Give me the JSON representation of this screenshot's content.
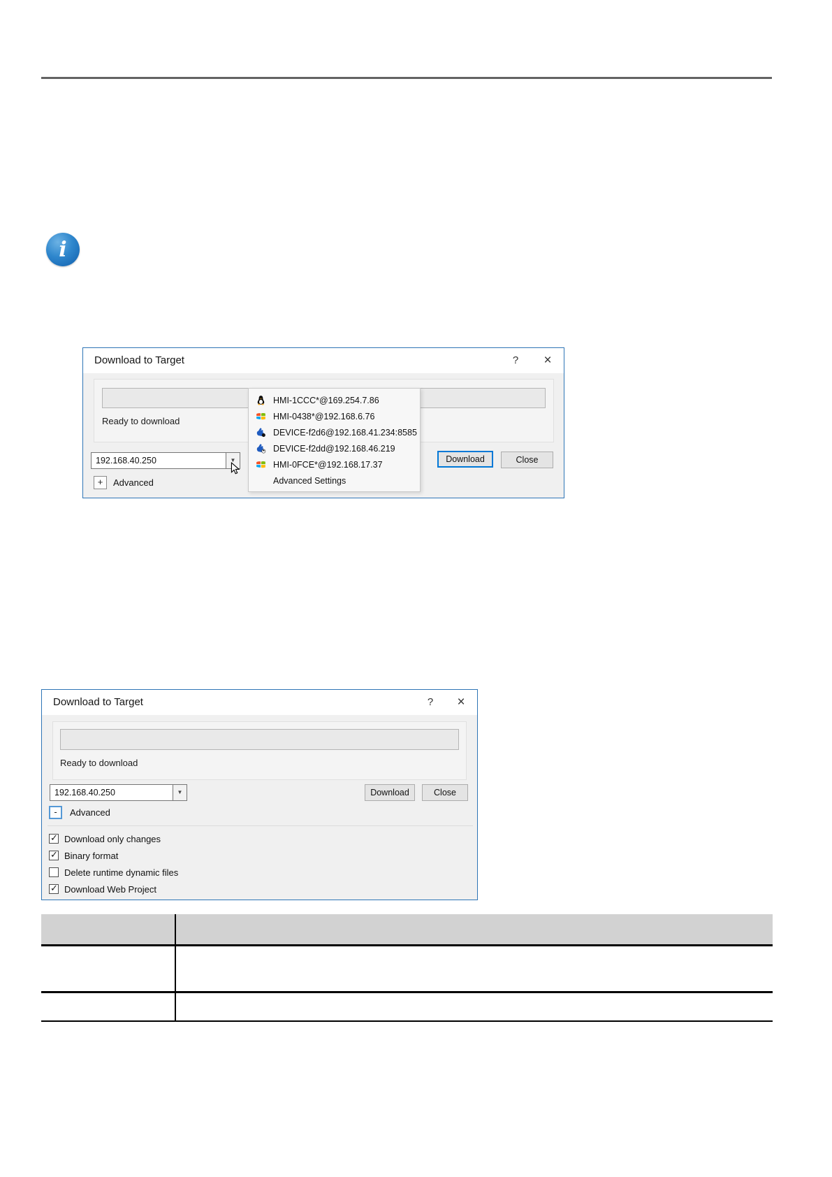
{
  "info_icon": {
    "glyph": "i"
  },
  "dialog1": {
    "title": "Download to Target",
    "help_label": "?",
    "close_label": "×",
    "status_text": "Ready to download",
    "address_value": "192.168.40.250",
    "advanced_toggle_label": "+",
    "advanced_label": "Advanced",
    "download_label": "Download",
    "close_button_label": "Close",
    "device_list": [
      {
        "icon": "linux-tux-icon",
        "label": "HMI-1CCC*@169.254.7.86"
      },
      {
        "icon": "windows-logo-icon",
        "label": "HMI-0438*@192.168.6.76"
      },
      {
        "icon": "device-hand-dark-icon",
        "label": "DEVICE-f2d6@192.168.41.234:8585"
      },
      {
        "icon": "device-hand-tux-icon",
        "label": "DEVICE-f2dd@192.168.46.219"
      },
      {
        "icon": "windows-logo-icon",
        "label": "HMI-0FCE*@192.168.17.37"
      },
      {
        "icon": "",
        "label": "Advanced Settings"
      }
    ]
  },
  "dialog2": {
    "title": "Download to Target",
    "help_label": "?",
    "close_label": "×",
    "status_text": "Ready to download",
    "address_value": "192.168.40.250",
    "advanced_toggle_label": "-",
    "advanced_label": "Advanced",
    "download_label": "Download",
    "close_button_label": "Close",
    "options": [
      {
        "label": "Download only changes",
        "checked": true
      },
      {
        "label": "Binary format",
        "checked": true
      },
      {
        "label": "Delete runtime dynamic files",
        "checked": false
      },
      {
        "label": "Download Web Project",
        "checked": true
      }
    ]
  },
  "table": {
    "header": [
      "",
      ""
    ],
    "rows": [
      [
        "",
        ""
      ],
      [
        "",
        ""
      ]
    ]
  },
  "colors": {
    "dialog_border": "#2e75b6",
    "accent_blue": "#0078d7",
    "dialog_bg": "#f0f0f0",
    "titlebar_bg": "#ffffff",
    "table_header_bg": "#d2d2d2",
    "rule_gray": "#636363",
    "info_icon_blue": "#2f87cd"
  }
}
